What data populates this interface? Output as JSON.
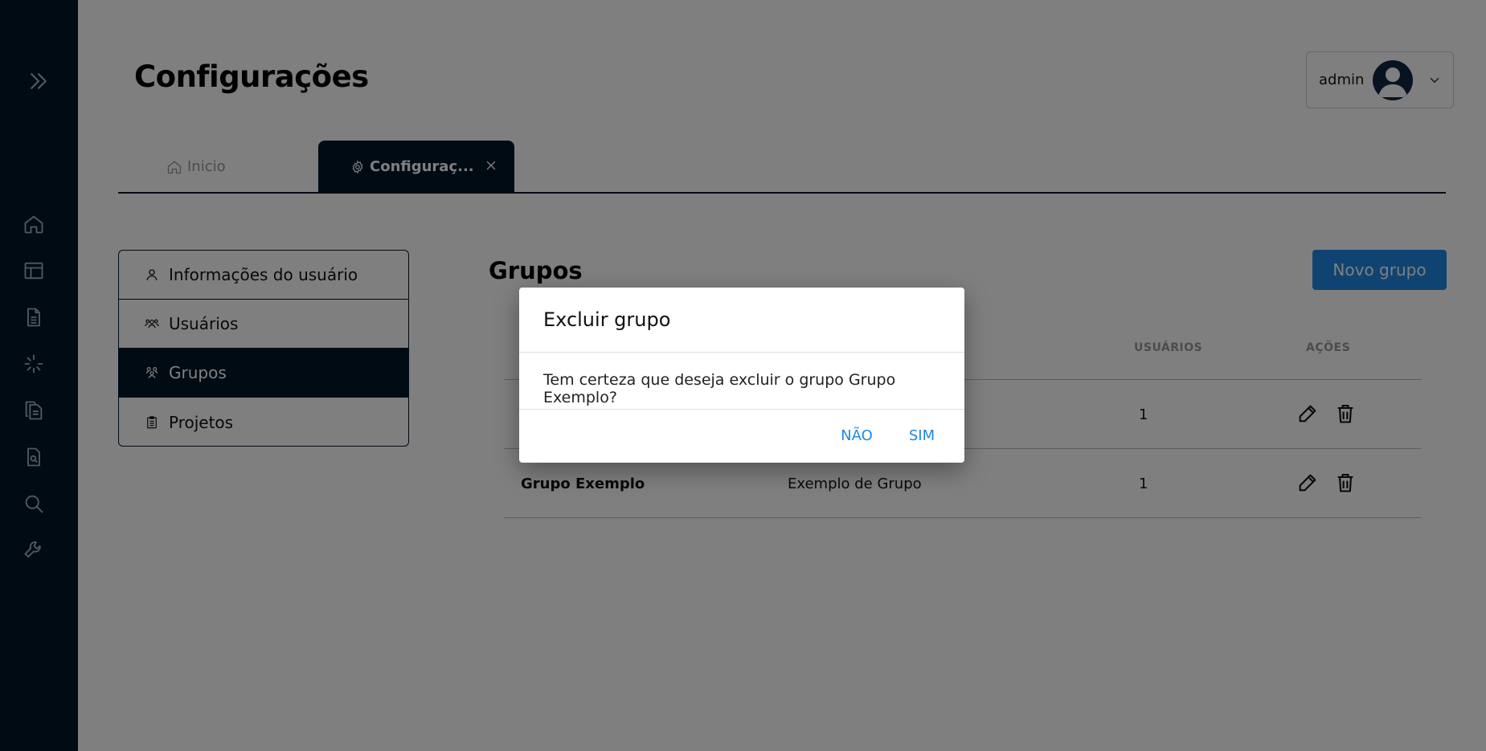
{
  "header": {
    "title": "Configurações",
    "user_name": "admin"
  },
  "tabs": [
    {
      "label": "Inicio",
      "icon": "home-icon"
    },
    {
      "label": "Configuraç...",
      "icon": "gear-icon"
    }
  ],
  "settings_menu": {
    "items": [
      {
        "label": "Informações do usuário",
        "icon": "user-icon"
      },
      {
        "label": "Usuários",
        "icon": "users-icon"
      },
      {
        "label": "Grupos",
        "icon": "groups-icon"
      },
      {
        "label": "Projetos",
        "icon": "clipboard-icon"
      }
    ]
  },
  "groups": {
    "title": "Grupos",
    "new_button": "Novo grupo",
    "columns": [
      "USUÁRIOS",
      "AÇÕES"
    ],
    "rows": [
      {
        "name": "",
        "description": "",
        "users": "1"
      },
      {
        "name": "Grupo Exemplo",
        "description": "Exemplo de Grupo",
        "users": "1"
      }
    ]
  },
  "dialog": {
    "title": "Excluir grupo",
    "message": "Tem certeza que deseja excluir o grupo Grupo Exemplo?",
    "cancel_label": "NÃO",
    "confirm_label": "SIM"
  },
  "colors": {
    "sidebar": "#011627",
    "accent": "#1e88e5",
    "overlay": "rgba(0,0,0,0.5)"
  }
}
